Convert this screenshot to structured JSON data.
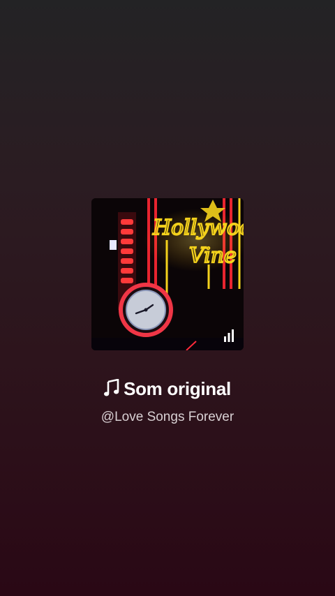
{
  "sound": {
    "title": "Som original",
    "author": "@Love Songs Forever",
    "artwork_sign_line1": "Hollywood",
    "artwork_sign_line2": "Vine"
  },
  "icons": {
    "title_icon": "music-note-icon",
    "playing_indicator": "audio-bars-icon"
  },
  "colors": {
    "background_top": "#232325",
    "background_bottom": "#2a0815",
    "title": "#ffffff",
    "author": "#d8d0d3",
    "neon_yellow": "#f4d21c",
    "neon_red": "#e8242f"
  }
}
